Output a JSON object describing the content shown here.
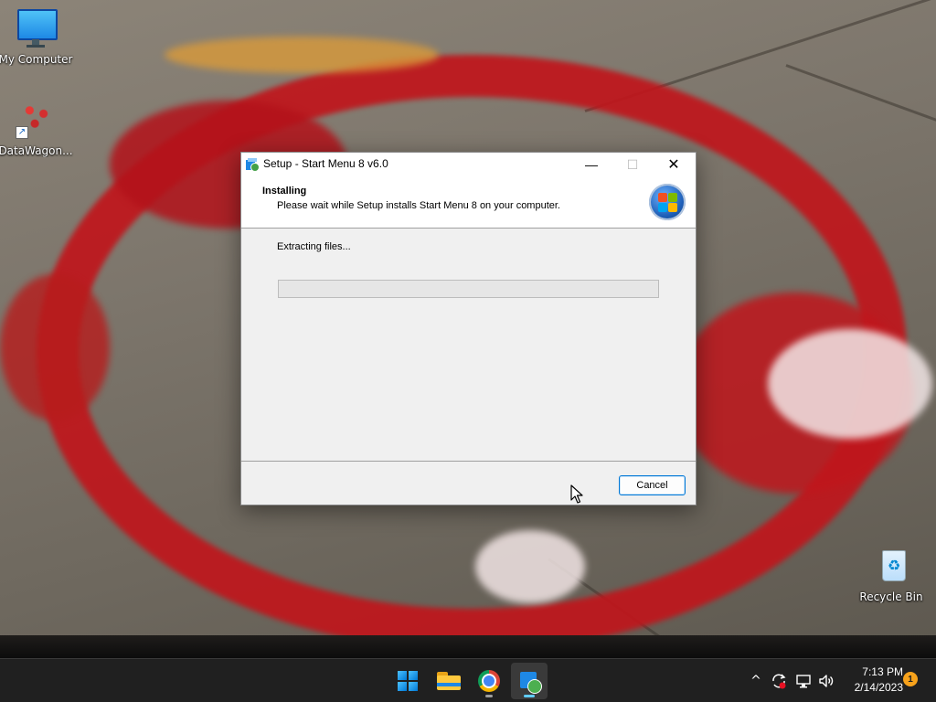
{
  "desktop": {
    "icons": [
      {
        "label": "My Computer",
        "icon": "monitor-icon"
      },
      {
        "label": "DataWagon...",
        "icon": "datawagon-shortcut-icon"
      },
      {
        "label": "Recycle Bin",
        "icon": "recycle-bin-icon"
      }
    ]
  },
  "dialog": {
    "title": "Setup - Start Menu 8 v6.0",
    "header_title": "Installing",
    "header_subtitle": "Please wait while Setup installs Start Menu 8 on your computer.",
    "status": "Extracting files...",
    "progress": 0.0,
    "cancel_label": "Cancel",
    "minimize_glyph": "—",
    "maximize_glyph": "☐",
    "close_glyph": "✕"
  },
  "taskbar": {
    "apps": [
      {
        "name": "start",
        "icon": "windows-logo-icon"
      },
      {
        "name": "file-explorer",
        "icon": "folder-icon"
      },
      {
        "name": "chrome",
        "icon": "chrome-icon"
      },
      {
        "name": "setup",
        "icon": "setup-icon"
      }
    ],
    "tray": {
      "chevron_glyph": "^",
      "clock_time": "7:13 PM",
      "clock_date": "2/14/2023",
      "notification_count": "1"
    }
  },
  "colors": {
    "accent": "#0078d7",
    "taskbar": "#202020",
    "badge": "#f7a21b"
  }
}
